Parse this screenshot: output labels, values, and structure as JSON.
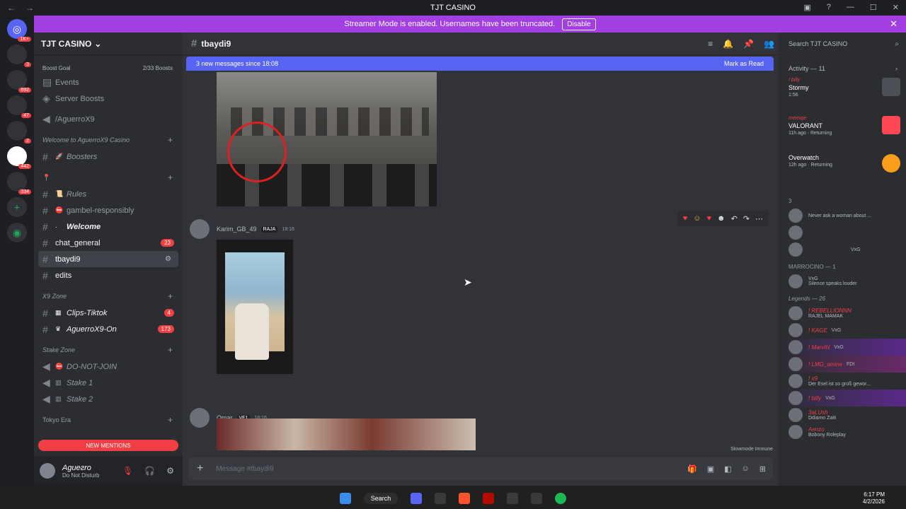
{
  "window": {
    "title": "TJT CASINO"
  },
  "banner": {
    "text": "Streamer Mode is enabled. Usernames have been truncated.",
    "disable_label": "Disable"
  },
  "guilds": {
    "badges": [
      "1K+",
      "3",
      "892",
      "47",
      "2",
      "442",
      "334"
    ]
  },
  "server": {
    "name": "TJT CASINO",
    "boost_goal": "Boost Goal",
    "boost_count": "2/33 Boosts",
    "events": "Events",
    "server_boosts": "Server Boosts",
    "aguerro_voice": "/AguerroX9",
    "cat_welcome": "Welcome to AguerroX9 Casino",
    "boosters": "Boosters",
    "rules": "Rules",
    "gambel": "gambel-responsibly",
    "welcome": "Welcome",
    "chat_general": "chat_general",
    "chat_general_badge": "23",
    "tbaydi9": "tbaydi9",
    "edits": "edits",
    "cat_x9": "X9 Zone",
    "clips": "Clips-Tiktok",
    "clips_badge": "4",
    "aguerro_on": "AguerroX9-On",
    "aguerro_on_badge": "173",
    "cat_stake": "Stake Zone",
    "dnj": "DO-NOT-JOIN",
    "stake1": "Stake 1",
    "stake2": "Stake 2",
    "cat_tokyo": "Tokyo Era",
    "new_mentions": "NEW MENTIONS"
  },
  "user": {
    "name": "Agueгro",
    "status": "Do Not Disturb"
  },
  "channel": {
    "name": "tbaydi9",
    "new_messages": "3 new messages since 18:08",
    "mark_read": "Mark as Read",
    "composer_placeholder": "Message #tbaydi9",
    "slowmode": "Slowmode Immune"
  },
  "messages": [
    {
      "author": "Karim_GB_49",
      "tag": "RAJA",
      "time": "18:16"
    },
    {
      "author": "Omar",
      "tag": "VF1",
      "time": "18:16"
    }
  ],
  "members": {
    "search_placeholder": "Search TJT CASINO",
    "activity_label": "Activity — 11",
    "activities": [
      {
        "user": "! billy",
        "game": "Stormy",
        "detail": "1:56"
      },
      {
        "user": "mernige",
        "game": "VALORANT",
        "detail": "11h ago · Returning"
      },
      {
        "user": "",
        "game": "Overwatch",
        "detail": "12h ago · Returning"
      }
    ],
    "group1": "3",
    "m1_status": "Never ask a woman about ...",
    "m3_tag": "VxG",
    "group2": "MARROCINO — 1",
    "m4_tag": "VxG",
    "m4_status": "Silence speaks louder",
    "group3": "Legends — 26",
    "legends": [
      {
        "name": "! REBELLIONNN",
        "status": "RAJEL MAMAK"
      },
      {
        "name": "! KAGE",
        "status": "VxG"
      },
      {
        "name": "! MarvIN",
        "status": "VxG"
      },
      {
        "name": "! LMG_amine",
        "status": "FDI"
      },
      {
        "name": "! x9",
        "status": "Der Esel ist so groß gewor..."
      },
      {
        "name": "! billy",
        "status": "VxG"
      },
      {
        "name": "3aLUsh",
        "status": "Ddiamo Zaiti"
      },
      {
        "name": "Aenzo",
        "status": "Bobony Roleplay"
      }
    ]
  },
  "taskbar": {
    "search": "Search",
    "time": "6:17 PM",
    "date": "4/2/2026"
  }
}
